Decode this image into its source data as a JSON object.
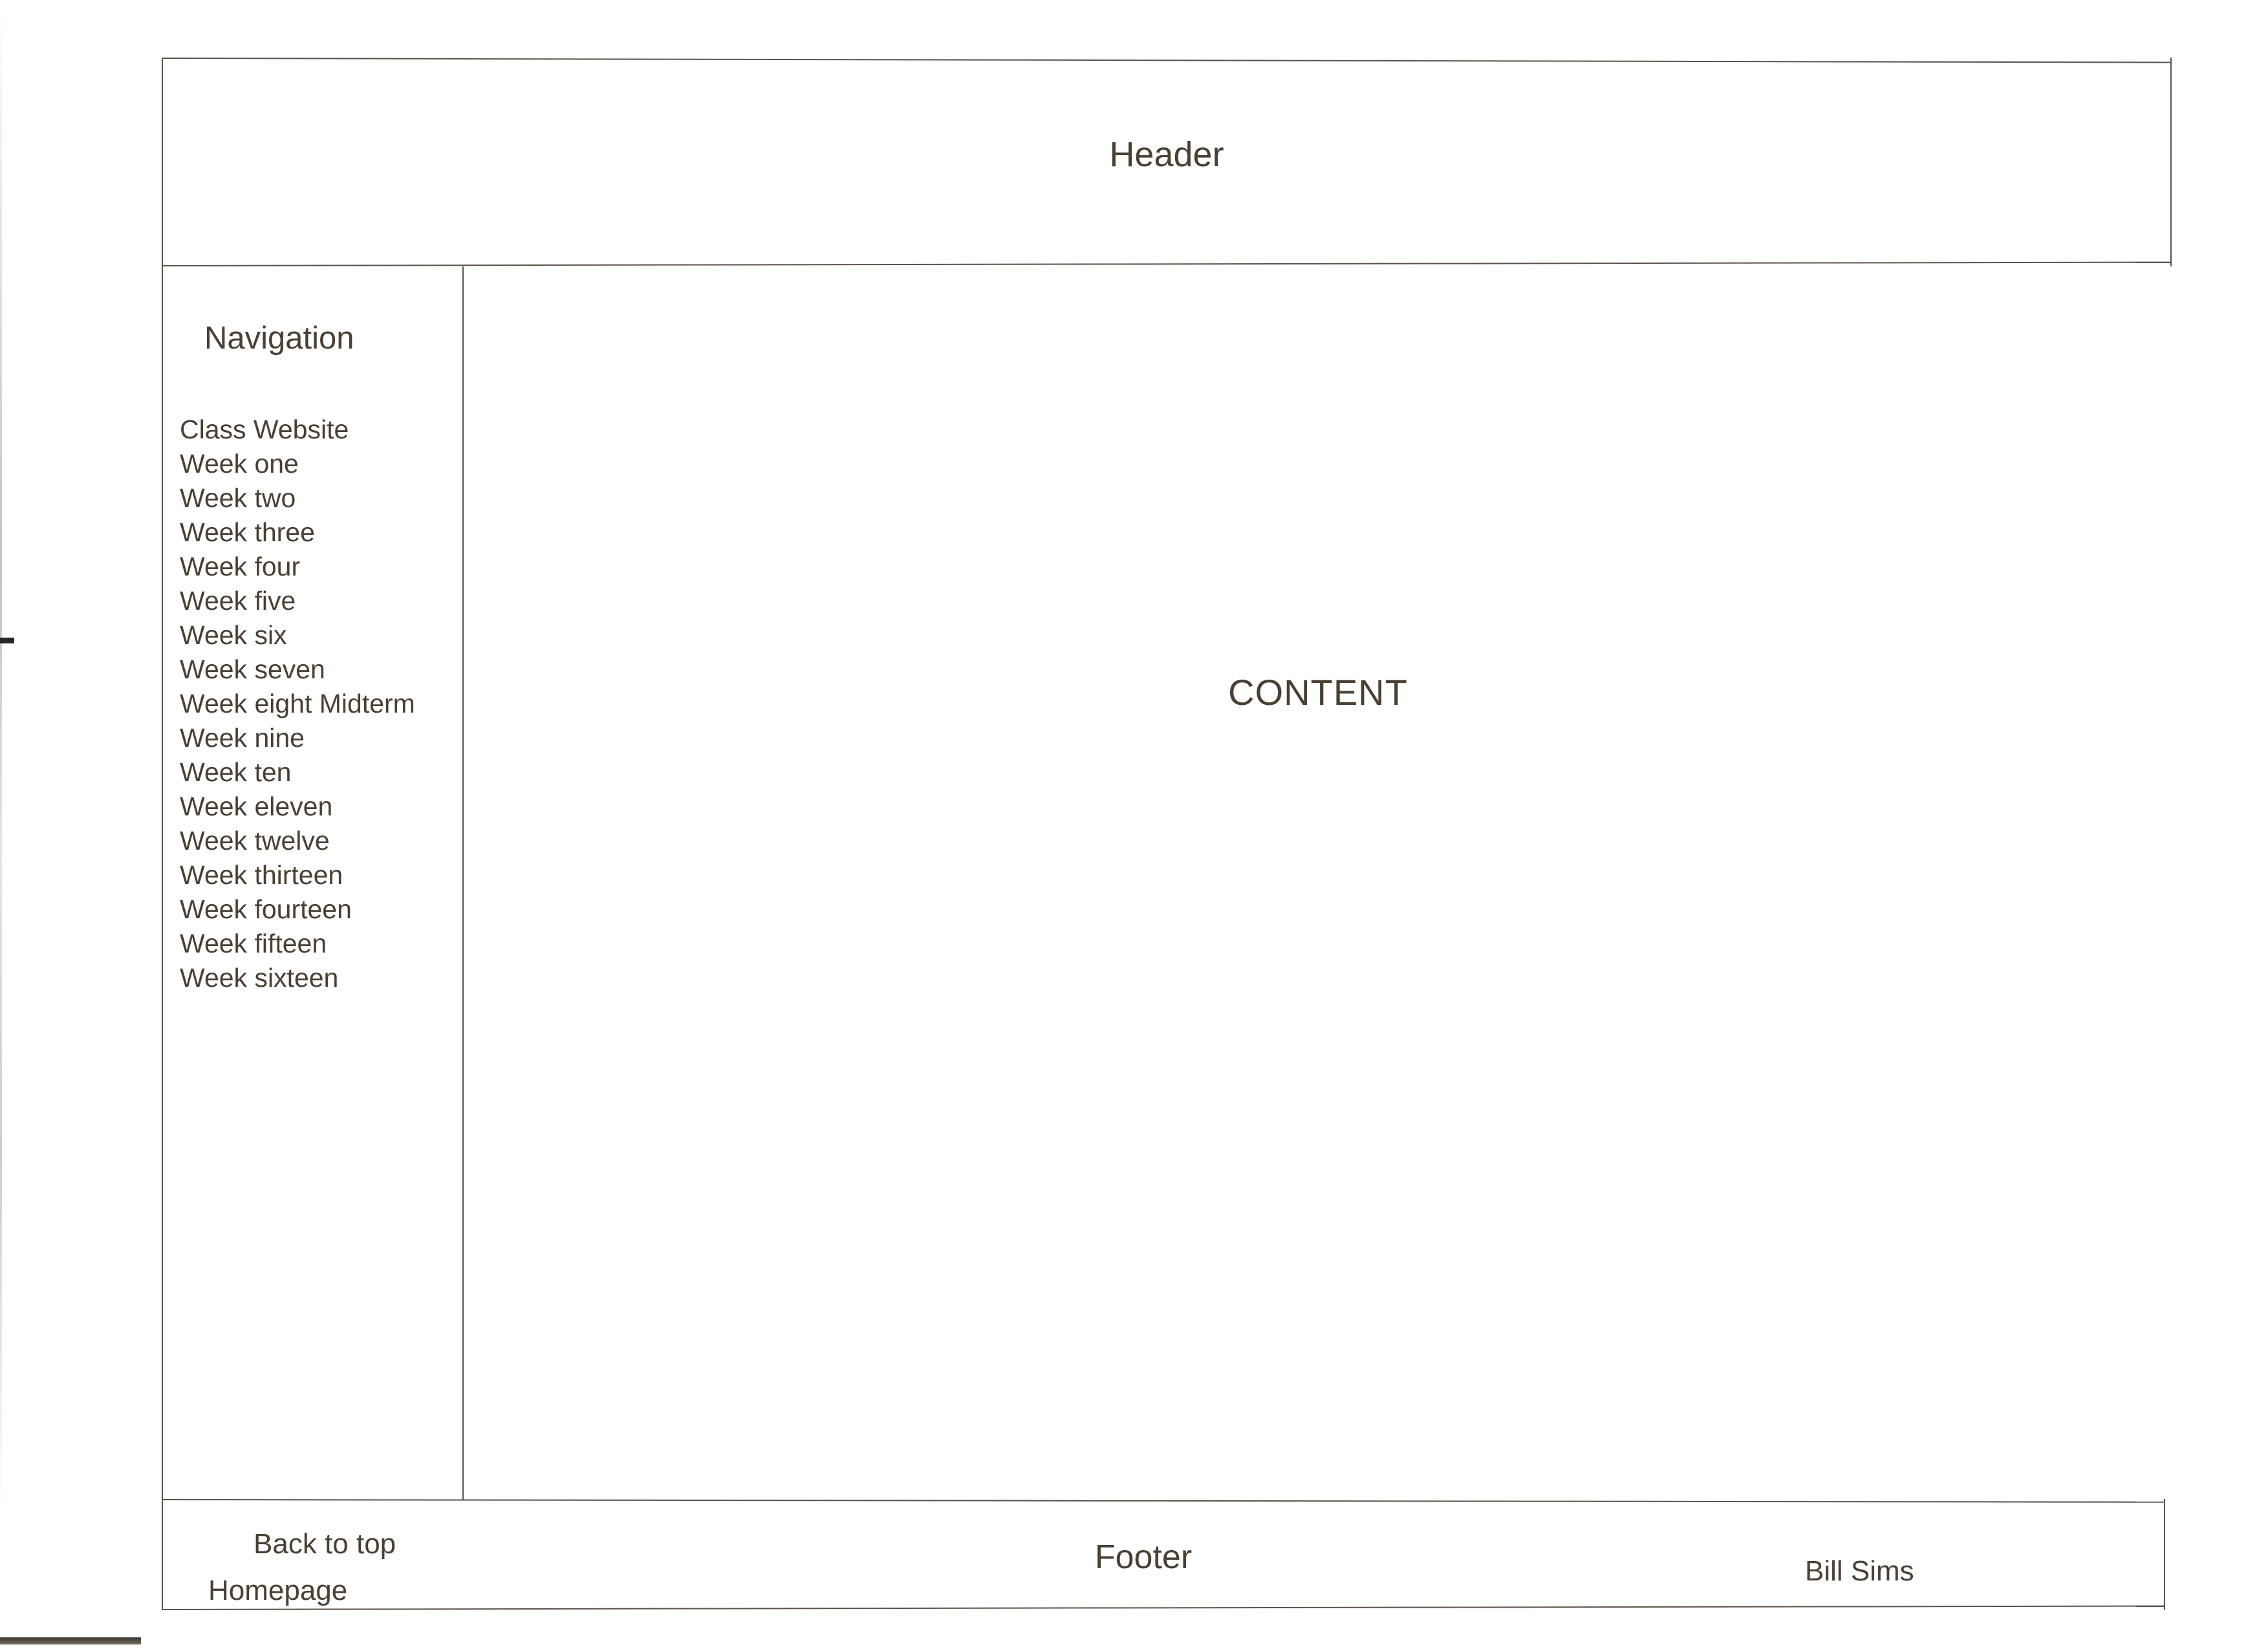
{
  "document": {
    "kind": "website-wireframe-sketch",
    "medium": "scanned-paper"
  },
  "header": {
    "title": "Header"
  },
  "navigation": {
    "heading": "Navigation",
    "items": [
      {
        "label": "Class Website"
      },
      {
        "label": "Week one"
      },
      {
        "label": "Week two"
      },
      {
        "label": "Week three"
      },
      {
        "label": "Week four"
      },
      {
        "label": "Week five"
      },
      {
        "label": "Week six"
      },
      {
        "label": "Week seven"
      },
      {
        "label": "Week eight Midterm"
      },
      {
        "label": "Week nine"
      },
      {
        "label": "Week ten"
      },
      {
        "label": "Week eleven"
      },
      {
        "label": "Week twelve"
      },
      {
        "label": "Week thirteen"
      },
      {
        "label": "Week fourteen"
      },
      {
        "label": "Week fifteen"
      },
      {
        "label": "Week sixteen"
      }
    ]
  },
  "main": {
    "title": "CONTENT"
  },
  "footer": {
    "title": "Footer",
    "back_to_top": "Back to top",
    "homepage": "Homepage",
    "author": "Bill Sims"
  },
  "colors": {
    "ink": "#4a3f33",
    "rule": "#5d5248",
    "paper": "#ffffff"
  }
}
